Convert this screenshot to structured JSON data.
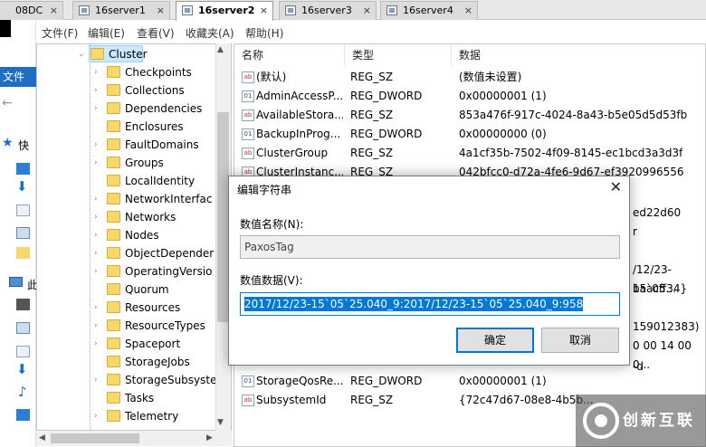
{
  "tabs": [
    {
      "label": "08DC"
    },
    {
      "label": "16server1"
    },
    {
      "label": "16server2"
    },
    {
      "label": "16server3"
    },
    {
      "label": "16server4"
    }
  ],
  "tab_close_glyph": "×",
  "left": {
    "file_button": "文件",
    "quick": "快",
    "this_pc": "此"
  },
  "menu": [
    "文件(F)",
    "编辑(E)",
    "查看(V)",
    "收藏夹(A)",
    "帮助(H)"
  ],
  "tree": {
    "selected": "Cluster",
    "children": [
      "Checkpoints",
      "Collections",
      "Dependencies",
      "Enclosures",
      "FaultDomains",
      "Groups",
      "LocalIdentity",
      "NetworkInterfac",
      "Networks",
      "Nodes",
      "ObjectDepender",
      "OperatingVersio",
      "Quorum",
      "Resources",
      "ResourceTypes",
      "Spaceport",
      "StorageJobs",
      "StorageSubsyste",
      "Tasks",
      "Telemetry"
    ]
  },
  "list": {
    "headers": [
      "名称",
      "类型",
      "数据"
    ],
    "rows": [
      {
        "icon": "string-value-icon",
        "name": "(默认)",
        "type": "REG_SZ",
        "data": "(数值未设置)"
      },
      {
        "icon": "binary-value-icon",
        "name": "AdminAccessP...",
        "type": "REG_DWORD",
        "data": "0x00000001 (1)"
      },
      {
        "icon": "string-value-icon",
        "name": "AvailableStora...",
        "type": "REG_SZ",
        "data": "853a476f-917c-4024-8a43-b5e05d5d53fb"
      },
      {
        "icon": "binary-value-icon",
        "name": "BackupInProg...",
        "type": "REG_DWORD",
        "data": "0x00000000 (0)"
      },
      {
        "icon": "string-value-icon",
        "name": "ClusterGroup",
        "type": "REG_SZ",
        "data": "4a1cf35b-7502-4f09-8145-ec1bcd3a3d3f"
      },
      {
        "icon": "string-value-icon",
        "name": "ClusterInstanc...",
        "type": "REG_SZ",
        "data": "042bfcc0-d72a-4fe6-9d67-ef3920996556"
      }
    ],
    "partial": [
      "ed22d60",
      "r",
      "/12/23-15`05...",
      "baacff34}",
      "159012383)",
      "0 00 14 00 0...",
      "-d"
    ],
    "bottom_rows": [
      {
        "icon": "binary-value-icon",
        "name": "StorageQosRe...",
        "type": "REG_DWORD",
        "data": "0x00000001 (1)"
      },
      {
        "icon": "string-value-icon",
        "name": "SubsystemId",
        "type": "REG_SZ",
        "data": "{72c47d67-08e8-4b5b..."
      }
    ]
  },
  "dialog": {
    "title": "编辑字符串",
    "close": "✕",
    "name_label": "数值名称(N):",
    "name_value": "PaxosTag",
    "data_label": "数值数据(V):",
    "data_value": "2017/12/23-15`05`25.040_9:2017/12/23-15`05`25.040_9:958",
    "ok": "确定",
    "cancel": "取消"
  },
  "watermark": {
    "text": "创新互联"
  }
}
